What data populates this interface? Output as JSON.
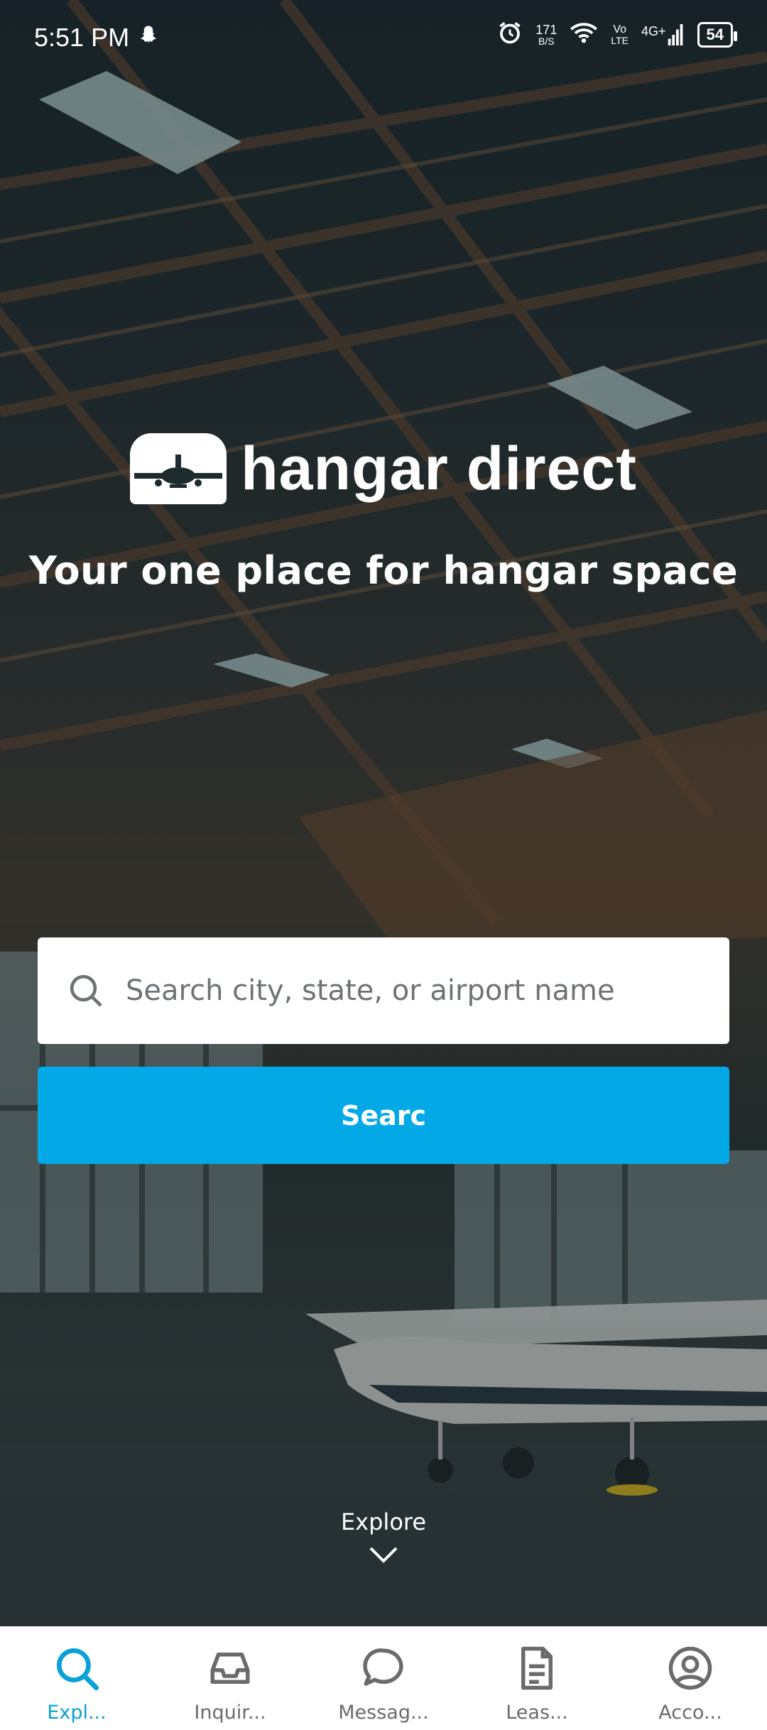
{
  "status_bar": {
    "time": "5:51 PM",
    "net_speed_value": "171",
    "net_speed_unit": "B/S",
    "volte_top": "Vo",
    "volte_bottom": "LTE",
    "network": "4G+",
    "battery": "54"
  },
  "brand": {
    "name": "hangar direct",
    "tagline": "Your one place for hangar space"
  },
  "search": {
    "placeholder": "Search city, state, or airport name",
    "button_label": "Searc"
  },
  "explore": {
    "label": "Explore"
  },
  "tabs": [
    {
      "label": "Expl...",
      "icon": "search-icon",
      "active": true
    },
    {
      "label": "Inquir...",
      "icon": "inbox-icon",
      "active": false
    },
    {
      "label": "Messag...",
      "icon": "chat-bubble-icon",
      "active": false
    },
    {
      "label": "Leas...",
      "icon": "document-icon",
      "active": false
    },
    {
      "label": "Acco...",
      "icon": "account-icon",
      "active": false
    }
  ],
  "colors": {
    "accent": "#02a9e6",
    "tab_active": "#0aa0d8",
    "tab_inactive": "#6b6b6b"
  }
}
